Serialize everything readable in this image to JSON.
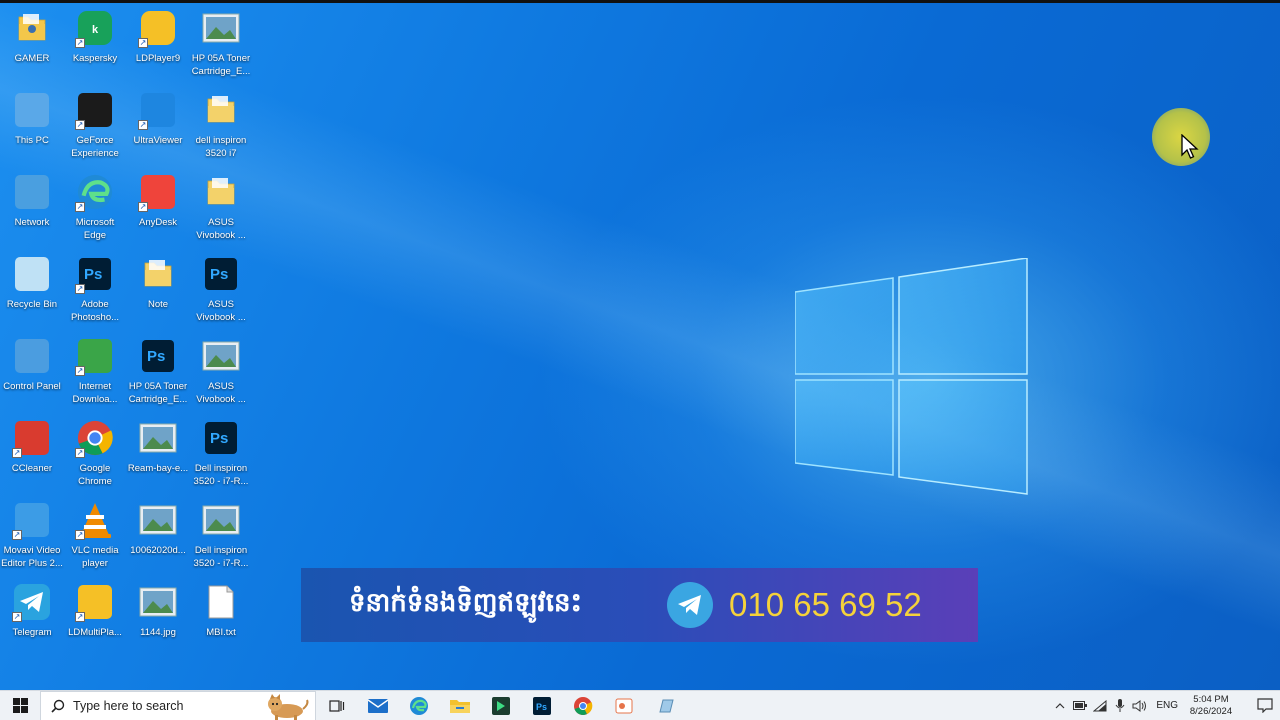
{
  "desktop": {
    "icons": [
      {
        "label": "GAMER",
        "icon": "folder-user-icon"
      },
      {
        "label": "Kaspersky",
        "icon": "kaspersky-icon"
      },
      {
        "label": "LDPlayer9",
        "icon": "ldplayer-icon"
      },
      {
        "label": "HP 05A Toner\nCartridge_E...",
        "icon": "image-file-icon"
      },
      {
        "label": "This PC",
        "icon": "computer-icon"
      },
      {
        "label": "GeForce\nExperience",
        "icon": "nvidia-icon"
      },
      {
        "label": "UltraViewer",
        "icon": "ultraviewer-icon"
      },
      {
        "label": "dell inspiron\n3520 i7",
        "icon": "folder-icon"
      },
      {
        "label": "Network",
        "icon": "network-icon"
      },
      {
        "label": "Microsoft\nEdge",
        "icon": "edge-icon"
      },
      {
        "label": "AnyDesk",
        "icon": "anydesk-icon"
      },
      {
        "label": "ASUS\nVivobook ...",
        "icon": "folder-icon"
      },
      {
        "label": "Recycle Bin",
        "icon": "recycle-bin-icon"
      },
      {
        "label": "Adobe\nPhotosho...",
        "icon": "photoshop-icon"
      },
      {
        "label": "Note",
        "icon": "folder-icon"
      },
      {
        "label": "ASUS\nVivobook ...",
        "icon": "psd-file-icon"
      },
      {
        "label": "Control Panel",
        "icon": "control-panel-icon"
      },
      {
        "label": "Internet\nDownloa...",
        "icon": "idm-icon"
      },
      {
        "label": "HP 05A Toner\nCartridge_E...",
        "icon": "psd-file-icon"
      },
      {
        "label": "ASUS\nVivobook ...",
        "icon": "image-file-icon"
      },
      {
        "label": "CCleaner",
        "icon": "ccleaner-icon"
      },
      {
        "label": "Google\nChrome",
        "icon": "chrome-icon"
      },
      {
        "label": "Ream-bay-e...",
        "icon": "image-file-icon"
      },
      {
        "label": "Dell inspiron\n3520 - i7-R...",
        "icon": "psd-file-icon"
      },
      {
        "label": "Movavi Video\nEditor Plus 2...",
        "icon": "movavi-icon"
      },
      {
        "label": "VLC media\nplayer",
        "icon": "vlc-icon"
      },
      {
        "label": "10062020d...",
        "icon": "image-file-icon"
      },
      {
        "label": "Dell inspiron\n3520 - i7-R...",
        "icon": "image-file-icon"
      },
      {
        "label": "Telegram",
        "icon": "telegram-icon"
      },
      {
        "label": "LDMultiPla...",
        "icon": "ldmultiplayer-icon"
      },
      {
        "label": "1144.jpg",
        "icon": "image-file-icon"
      },
      {
        "label": "MBI.txt",
        "icon": "text-file-icon"
      }
    ]
  },
  "banner": {
    "khmer_text": "ទំនាក់ទំនងទិញឥឡូវនេះ",
    "phone": "010 65 69 52",
    "icon": "telegram-icon",
    "colors": {
      "bg_start": "#1a55b0",
      "bg_end": "#5a3fb8",
      "phone": "#f5d23a"
    }
  },
  "taskbar": {
    "search_placeholder": "Type here to search",
    "apps": [
      "task-view-icon",
      "mail-icon",
      "edge-icon",
      "file-explorer-icon",
      "app-icon",
      "photoshop-icon",
      "chrome-icon",
      "office-icon",
      "app-icon"
    ],
    "tray": {
      "lang": "ENG",
      "time": "5:04 PM",
      "date": "8/26/2024"
    }
  }
}
